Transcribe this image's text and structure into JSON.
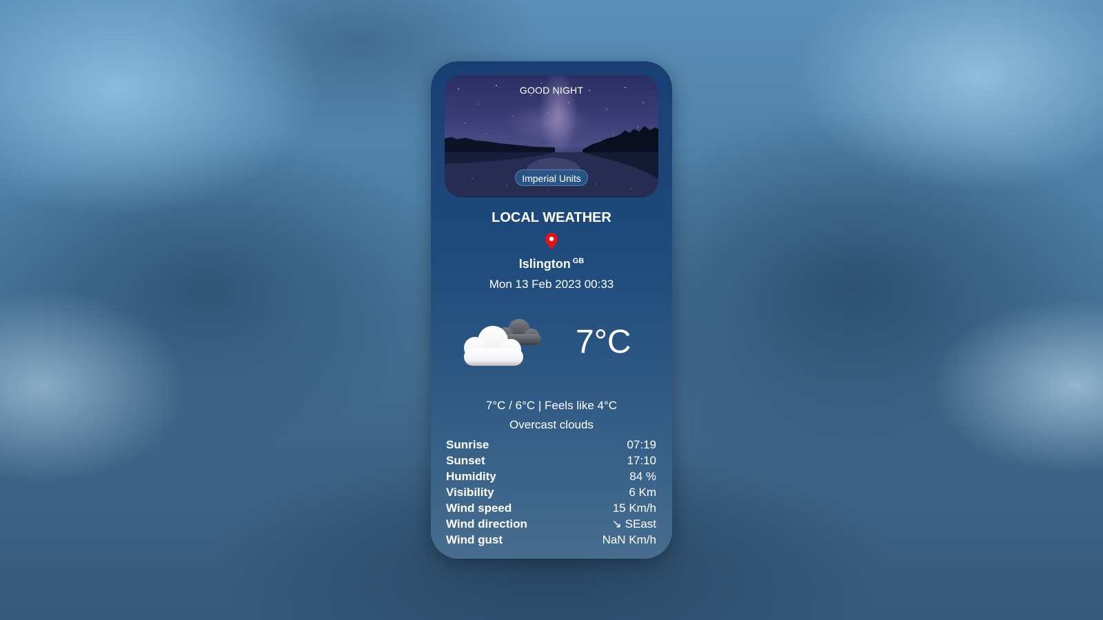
{
  "header": {
    "greeting": "GOOD NIGHT",
    "units_button_label": "Imperial Units",
    "title": "LOCAL WEATHER"
  },
  "location": {
    "city": "Islington",
    "country": "GB",
    "datetime": "Mon 13 Feb 2023 00:33",
    "icon": "map-pin-icon"
  },
  "current": {
    "icon": "overcast-clouds-icon",
    "temperature": "7°C",
    "min_max_feels": "7°C  /  6°C  | Feels like 4°C",
    "description": "Overcast clouds"
  },
  "details": [
    {
      "label": "Sunrise",
      "value": "07:19"
    },
    {
      "label": "Sunset",
      "value": "17:10"
    },
    {
      "label": "Humidity",
      "value": "84 %"
    },
    {
      "label": "Visibility",
      "value": "6 Km"
    },
    {
      "label": "Wind speed",
      "value": "15 Km/h"
    },
    {
      "label": "Wind direction",
      "value": "↘ SEast"
    },
    {
      "label": "Wind gust",
      "value": "NaN Km/h"
    }
  ],
  "colors": {
    "card_top": "#183f73",
    "card_bottom": "#466d8e",
    "pin": "#e3131b",
    "text": "#ffffff"
  }
}
